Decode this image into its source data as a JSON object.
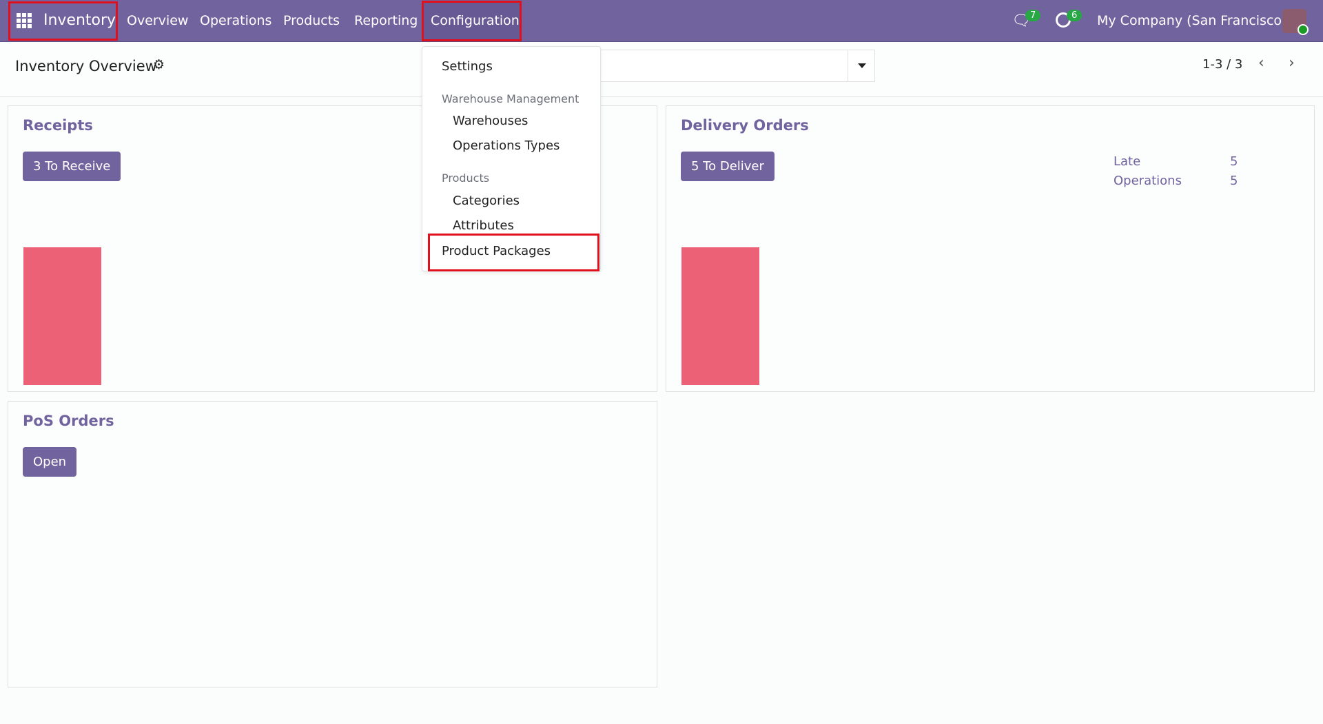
{
  "navbar": {
    "app_name": "Inventory",
    "items": [
      "Overview",
      "Operations",
      "Products",
      "Reporting",
      "Configuration"
    ],
    "messages_count": "7",
    "activities_count": "6",
    "company": "My Company (San Francisco)"
  },
  "control_panel": {
    "title": "Inventory Overview",
    "pager": "1-3 / 3"
  },
  "config_menu": {
    "settings": "Settings",
    "warehouse_header": "Warehouse Management",
    "warehouses": "Warehouses",
    "operations_types": "Operations Types",
    "products_header": "Products",
    "categories": "Categories",
    "attributes": "Attributes",
    "product_packages": "Product Packages"
  },
  "cards": {
    "receipts": {
      "title": "Receipts",
      "button": "3 To Receive"
    },
    "delivery": {
      "title": "Delivery Orders",
      "button": "5 To Deliver",
      "stats": [
        {
          "label": "Late",
          "value": "5"
        },
        {
          "label": "Operations",
          "value": "5"
        }
      ]
    },
    "pos": {
      "title": "PoS Orders",
      "button": "Open"
    }
  },
  "colors": {
    "brand": "#71639e",
    "bar": "#ec6175",
    "highlight": "#e0111c",
    "badge": "#28a745"
  }
}
